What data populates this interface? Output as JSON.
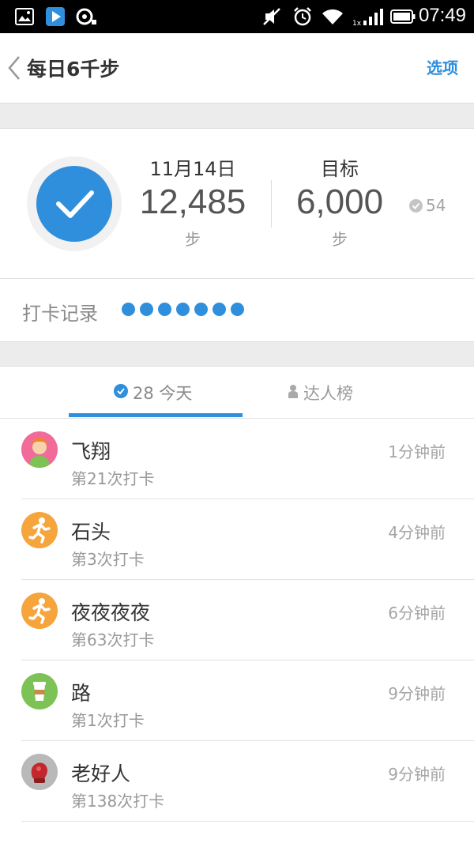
{
  "status_bar": {
    "time": "07:49",
    "icons": [
      "gallery-icon",
      "play-store-icon",
      "music-icon",
      "mute-icon",
      "alarm-icon",
      "wifi-icon",
      "signal-icon",
      "battery-icon"
    ]
  },
  "header": {
    "title": "每日6千步",
    "options_label": "选项"
  },
  "summary": {
    "date_label": "11月14日",
    "steps_value": "12,485",
    "steps_unit": "步",
    "goal_label": "目标",
    "goal_value": "6,000",
    "goal_unit": "步",
    "badge_count": "54"
  },
  "checkin": {
    "label": "打卡记录",
    "dot_count": 7
  },
  "tabs": {
    "today_label": "28 今天",
    "leaders_label": "达人榜"
  },
  "records": [
    {
      "name": "飞翔",
      "count": "第21次打卡",
      "time": "1分钟前",
      "avatar": "person-avatar"
    },
    {
      "name": "石头",
      "count": "第3次打卡",
      "time": "4分钟前",
      "avatar": "runner-avatar"
    },
    {
      "name": "夜夜夜夜",
      "count": "第63次打卡",
      "time": "6分钟前",
      "avatar": "runner-avatar"
    },
    {
      "name": "路",
      "count": "第1次打卡",
      "time": "9分钟前",
      "avatar": "cup-avatar"
    },
    {
      "name": "老好人",
      "count": "第138次打卡",
      "time": "9分钟前",
      "avatar": "boxing-glove-avatar"
    }
  ],
  "colors": {
    "accent": "#2f8fdc",
    "orange": "#f5a53c",
    "green": "#7cc255",
    "pink": "#f06a9a"
  }
}
